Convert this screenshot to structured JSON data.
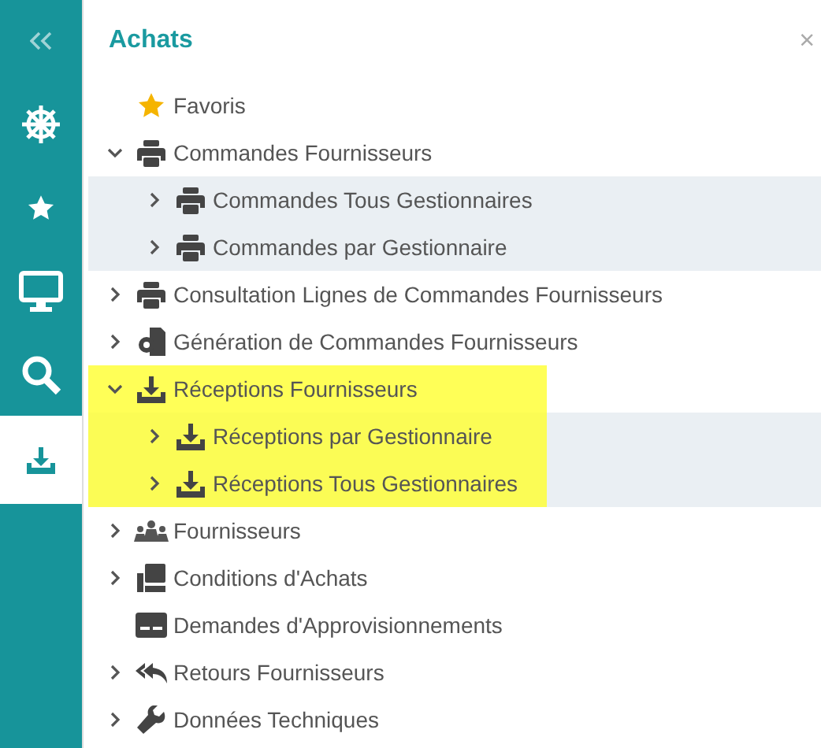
{
  "rail": {
    "items": [
      {
        "kind": "wheel",
        "selected": false
      },
      {
        "kind": "star",
        "selected": false
      },
      {
        "kind": "monitor",
        "selected": false
      },
      {
        "kind": "search",
        "selected": false
      },
      {
        "kind": "download",
        "selected": true
      }
    ]
  },
  "panel": {
    "title": "Achats",
    "close": "×",
    "tree": [
      {
        "label": "Favoris",
        "kind": "star",
        "highlighted": false
      },
      {
        "label": "Commandes Fournisseurs",
        "kind": "printer",
        "expandable": true,
        "expanded": true,
        "highlighted": false,
        "children": [
          {
            "label": "Commandes Tous Gestionnaires",
            "kind": "printer",
            "expandable": true,
            "expanded": false,
            "highlighted": false
          },
          {
            "label": "Commandes par Gestionnaire",
            "kind": "printer",
            "expandable": true,
            "expanded": false,
            "highlighted": false
          }
        ]
      },
      {
        "label": "Consultation Lignes de Commandes Fournisseurs",
        "kind": "printer",
        "expandable": true,
        "expanded": false,
        "highlighted": false
      },
      {
        "label": "Génération de Commandes Fournisseurs",
        "kind": "generate",
        "expandable": true,
        "expanded": false,
        "highlighted": false
      },
      {
        "label": "Réceptions Fournisseurs",
        "kind": "download",
        "expandable": true,
        "expanded": true,
        "highlighted": true,
        "children": [
          {
            "label": "Réceptions par Gestionnaire",
            "kind": "download",
            "expandable": true,
            "expanded": false,
            "highlighted": true
          },
          {
            "label": "Réceptions Tous Gestionnaires",
            "kind": "download",
            "expandable": true,
            "expanded": false,
            "highlighted": true
          }
        ]
      },
      {
        "label": "Fournisseurs",
        "kind": "people",
        "expandable": true,
        "expanded": false,
        "highlighted": false
      },
      {
        "label": "Conditions d'Achats",
        "kind": "books",
        "expandable": true,
        "expanded": false,
        "highlighted": false
      },
      {
        "label": "Demandes d'Approvisionnements",
        "kind": "card",
        "highlighted": false
      },
      {
        "label": "Retours Fournisseurs",
        "kind": "reply",
        "expandable": true,
        "expanded": false,
        "highlighted": false
      },
      {
        "label": "Données Techniques",
        "kind": "wrench",
        "expandable": true,
        "expanded": false,
        "highlighted": false
      }
    ]
  }
}
